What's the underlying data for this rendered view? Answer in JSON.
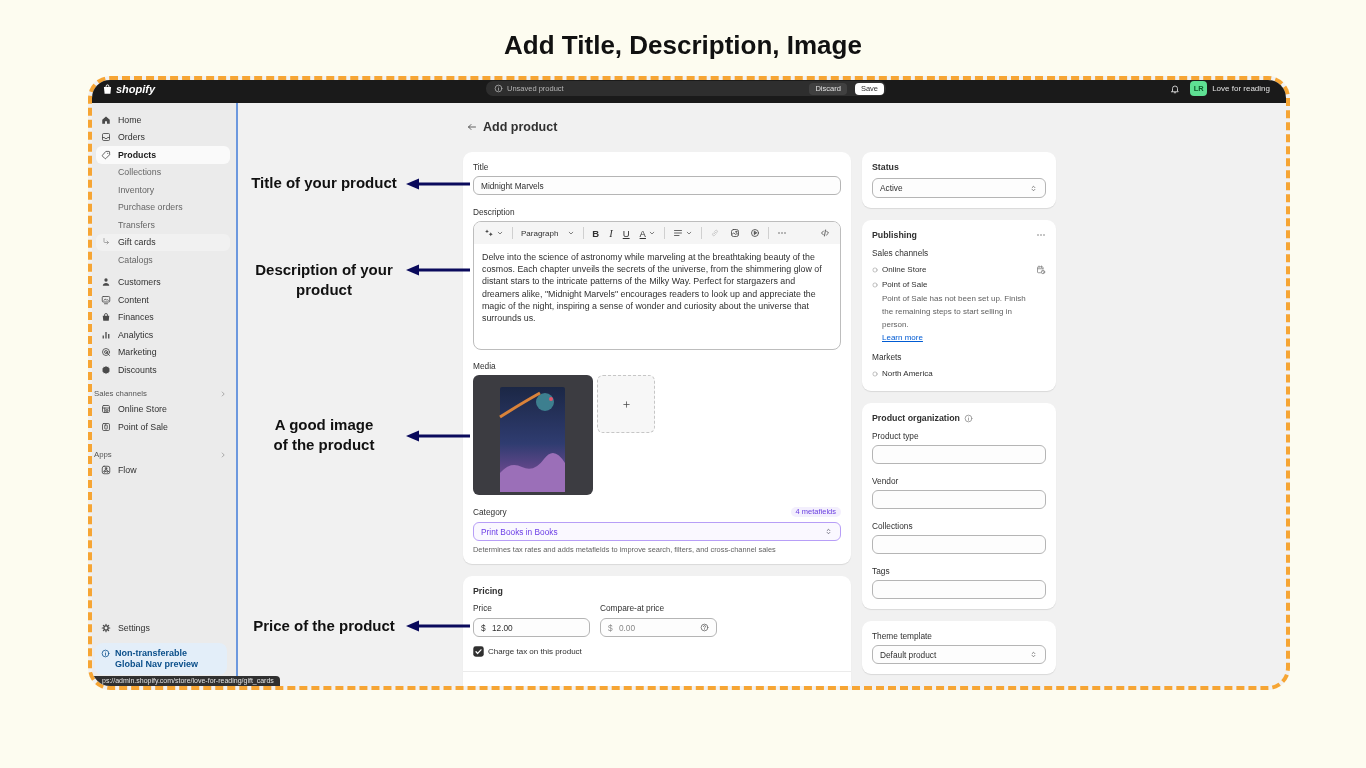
{
  "heading": "Add Title, Description, Image",
  "annotations": [
    {
      "text": "Title of your product"
    },
    {
      "text": "Description of your\nproduct"
    },
    {
      "text": "A good image\nof the product"
    },
    {
      "text": "Price of the product"
    }
  ],
  "top_bar": {
    "logo": "shopify",
    "notice": "Unsaved product",
    "buttons": [
      {
        "label": "Discard",
        "kind": "secondary"
      },
      {
        "label": "Save",
        "kind": "primary"
      }
    ],
    "store": {
      "initials": "LR",
      "name": "Love for reading"
    }
  },
  "sidebar": {
    "items": [
      {
        "label": "Home",
        "selected": false
      },
      {
        "label": "Orders",
        "selected": false
      },
      {
        "label": "Products",
        "selected": true,
        "children": [
          {
            "label": "Collections",
            "selected": false,
            "hovered": false
          },
          {
            "label": "Inventory",
            "selected": false,
            "hovered": false
          },
          {
            "label": "Purchase orders",
            "selected": false,
            "hovered": false
          },
          {
            "label": "Transfers",
            "selected": false,
            "hovered": false
          },
          {
            "label": "Gift cards",
            "selected": false,
            "hovered": true
          },
          {
            "label": "Catalogs",
            "selected": false,
            "hovered": false
          }
        ]
      },
      {
        "label": "Customers",
        "selected": false
      },
      {
        "label": "Content",
        "selected": false
      },
      {
        "label": "Finances",
        "selected": false
      },
      {
        "label": "Analytics",
        "selected": false
      },
      {
        "label": "Marketing",
        "selected": false
      },
      {
        "label": "Discounts",
        "selected": false
      }
    ],
    "sections": [
      {
        "title": "Sales channels",
        "items": [
          {
            "label": "Online Store",
            "selected": false
          },
          {
            "label": "Point of Sale",
            "selected": false
          }
        ]
      },
      {
        "title": "Apps",
        "items": [
          {
            "label": "Flow",
            "selected": false
          }
        ]
      }
    ],
    "settings": {
      "label": "Settings",
      "selected": false
    },
    "notice": "Non-transferable Global Nav preview"
  },
  "url_tooltip": "ps://admin.shopify.com/store/love-for-reading/gift_cards",
  "page": {
    "title": "Add product"
  },
  "product": {
    "title": {
      "label": "Title",
      "value": "Midnight Marvels"
    },
    "description": {
      "label": "Description",
      "toolbar": [
        [
          {
            "kind": "sparkle",
            "caret": true,
            "disabled": false
          }
        ],
        [
          {
            "kind": "format",
            "label": "Paragraph",
            "caret": true,
            "disabled": false
          }
        ],
        [
          {
            "kind": "bold",
            "label": "B",
            "caret": false,
            "disabled": false
          },
          {
            "kind": "italic",
            "label": "I",
            "caret": false,
            "disabled": false
          },
          {
            "kind": "underline",
            "label": "U",
            "caret": false,
            "disabled": false
          },
          {
            "kind": "color",
            "label": "A",
            "caret": true,
            "disabled": false
          }
        ],
        [
          {
            "kind": "align",
            "caret": true,
            "disabled": false
          }
        ],
        [
          {
            "kind": "link",
            "caret": false,
            "disabled": true
          },
          {
            "kind": "image",
            "caret": false,
            "disabled": false
          },
          {
            "kind": "video",
            "caret": false,
            "disabled": false
          }
        ],
        [
          {
            "kind": "more",
            "caret": false,
            "disabled": false
          },
          {
            "kind": "code",
            "caret": false,
            "disabled": false
          }
        ]
      ],
      "text": "Delve into the science of astronomy while marveling at the breathtaking beauty of the cosmos. Each chapter unveils the secrets of the universe, from the shimmering glow of distant stars to the intricate patterns of the Milky Way. Perfect for stargazers and dreamers alike, \"Midnight Marvels\" encourages readers to look up and appreciate the magic of the night, inspiring a sense of wonder and curiosity about the universe that surrounds us."
    },
    "media": {
      "label": "Media",
      "items": [
        {
          "kind": "image"
        },
        {
          "kind": "add"
        }
      ]
    },
    "category": {
      "label": "Category",
      "badge": "4 metafields",
      "value": "Print Books in Books",
      "help": "Determines tax rates and adds metafields to improve search, filters, and cross-channel sales"
    }
  },
  "pricing": {
    "title": "Pricing",
    "fields": [
      {
        "label": "Price",
        "prefix": "$",
        "value": "12.00",
        "help_icon": false
      },
      {
        "label": "Compare-at price",
        "prefix": "$",
        "placeholder": "0.00",
        "help_icon": true
      }
    ],
    "charge_tax": {
      "label": "Charge tax on this product",
      "checked": true
    }
  },
  "status": {
    "title": "Status",
    "value": "Active"
  },
  "publishing": {
    "title": "Publishing",
    "sales_channels": {
      "label": "Sales channels",
      "items": [
        {
          "name": "Online Store",
          "schedule_icon": true
        },
        {
          "name": "Point of Sale",
          "schedule_icon": false,
          "note": "Point of Sale has not been set up. Finish the remaining steps to start selling in person.",
          "link": "Learn more"
        }
      ]
    },
    "markets": {
      "label": "Markets",
      "items": [
        {
          "name": "North America"
        }
      ]
    }
  },
  "organization": {
    "title": "Product organization",
    "fields": [
      {
        "label": "Product type"
      },
      {
        "label": "Vendor"
      },
      {
        "label": "Collections"
      },
      {
        "label": "Tags"
      }
    ]
  },
  "theme_template": {
    "label": "Theme template",
    "value": "Default product"
  }
}
